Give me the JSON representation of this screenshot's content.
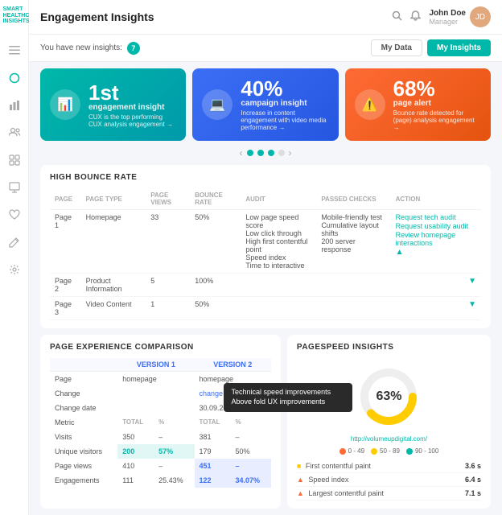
{
  "app": {
    "name": "SMART HEALTHCARE INSIGHTS",
    "title": "Engagement Insights"
  },
  "header": {
    "title": "Engagement Insights",
    "search_icon": "search",
    "bell_icon": "bell",
    "user": {
      "name": "John Doe",
      "role": "Manager",
      "avatar_initials": "JD"
    },
    "btn_my_data": "My Data",
    "btn_my_insights": "My Insights"
  },
  "insights_bar": {
    "notice": "You have new insights:",
    "count": "7"
  },
  "cards": [
    {
      "number": "1st",
      "label": "engagement insight",
      "desc": "CUX is the top performing CUX analysis engagement →",
      "link": "analysis engagement →",
      "color": "teal",
      "icon": "📊"
    },
    {
      "number": "40%",
      "label": "campaign insight",
      "desc": "Increase in content engagement with video media performance →",
      "link": "media performance →",
      "color": "blue",
      "icon": "💻"
    },
    {
      "number": "68%",
      "label": "page alert",
      "desc": "Bounce rate detected for (page) analysis engagement →",
      "link": "analysis engagement →",
      "color": "orange",
      "icon": "⚠️"
    }
  ],
  "dots": [
    1,
    2,
    3,
    4
  ],
  "active_dot": 1,
  "bounce_table": {
    "title": "HIGH BOUNCE RATE",
    "columns": [
      "PAGE",
      "PAGE TYPE",
      "PAGE VIEWS",
      "BOUNCE RATE",
      "AUDIT",
      "PASSED CHECKS",
      "ACTION"
    ],
    "rows": [
      {
        "page": "Page 1",
        "type": "Homepage",
        "views": "33",
        "bounce": "50%",
        "audit": [
          "Low page speed score",
          "Low click through",
          "High first contentful point",
          "Speed index",
          "Time to interactive"
        ],
        "passed": [
          "Mobile-friendly test",
          "Cumulative layout shifts",
          "200 server response"
        ],
        "actions": [
          "Request tech audit",
          "Request usability audit",
          "Review homepage interactions"
        ],
        "expanded": true
      },
      {
        "page": "Page 2",
        "type": "Product Information",
        "views": "5",
        "bounce": "100%",
        "audit": [],
        "passed": [],
        "actions": [],
        "expanded": false
      },
      {
        "page": "Page 3",
        "type": "Video Content",
        "views": "1",
        "bounce": "50%",
        "audit": [],
        "passed": [],
        "actions": [],
        "expanded": false
      }
    ]
  },
  "comparison": {
    "title": "PAGE EXPERIENCE COMPARISON",
    "version1": "VERSION 1",
    "version2": "VERSION 2",
    "rows": [
      {
        "label": "Page",
        "v1": "homepage",
        "v2": "homepage"
      },
      {
        "label": "Change",
        "v1": "",
        "v2": "change",
        "v2_link": true
      },
      {
        "label": "Change date",
        "v1": "",
        "v2": "30.09.2020"
      },
      {
        "label": "Metric",
        "v1_sub": "TOTAL",
        "v1_pct": "%",
        "v2_sub": "TOTAL",
        "v2_pct": "%"
      },
      {
        "label": "Visits",
        "v1_total": "350",
        "v1_pct_val": "–",
        "v2_total": "381",
        "v2_pct_val": "–"
      },
      {
        "label": "Unique visitors",
        "v1_total": "200",
        "v1_pct_val": "57%",
        "v2_total": "179",
        "v2_pct_val": "50%",
        "v1_highlight": true
      },
      {
        "label": "Page views",
        "v1_total": "410",
        "v1_pct_val": "–",
        "v2_total": "451",
        "v2_pct_val": "–",
        "v2_highlight": true
      },
      {
        "label": "Engagements",
        "v1_total": "111",
        "v1_pct_val": "25.43%",
        "v2_total": "122",
        "v2_pct_val": "34.07%",
        "v2_highlight": true
      }
    ],
    "tooltip": {
      "items": [
        "Technical speed improvements",
        "Above fold UX improvements"
      ]
    }
  },
  "pagespeed": {
    "title": "PAGESPEED INSIGHTS",
    "score": "63%",
    "url": "http://volumeupdigital.com/",
    "legend": [
      {
        "label": "0 - 49",
        "color": "#ff6b35"
      },
      {
        "label": "50 - 89",
        "color": "#ffcc00"
      },
      {
        "label": "90 - 100",
        "color": "#00b8a9"
      }
    ],
    "metrics": [
      {
        "label": "First contentful paint",
        "value": "3.6 s",
        "icon": "square"
      },
      {
        "label": "Speed index",
        "value": "6.4 s",
        "icon": "triangle"
      },
      {
        "label": "Largest contentful paint",
        "value": "7.1 s",
        "icon": "triangle"
      }
    ],
    "donut": {
      "value": 63,
      "colors": {
        "fill": "#ffcc00",
        "empty": "#eee"
      }
    }
  },
  "sidebar": {
    "items": [
      {
        "icon": "☰",
        "name": "menu"
      },
      {
        "icon": "○",
        "name": "circle-nav"
      },
      {
        "icon": "📊",
        "name": "chart"
      },
      {
        "icon": "👤",
        "name": "user"
      },
      {
        "icon": "⬜",
        "name": "square"
      },
      {
        "icon": "🖥",
        "name": "monitor"
      },
      {
        "icon": "♡",
        "name": "heart"
      },
      {
        "icon": "✏️",
        "name": "edit"
      },
      {
        "icon": "⚙",
        "name": "settings"
      }
    ]
  }
}
